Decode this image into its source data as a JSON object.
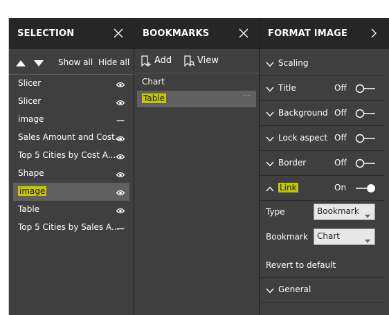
{
  "selection": {
    "title": "SELECTION",
    "show_all": "Show all",
    "hide_all": "Hide all",
    "items": [
      {
        "label": "Slicer",
        "visibility": "eye-icon"
      },
      {
        "label": "Slicer",
        "visibility": "eye-icon"
      },
      {
        "label": "image",
        "visibility": "hidden-dash-icon"
      },
      {
        "label": "Sales Amount and Cost...",
        "visibility": "eye-icon"
      },
      {
        "label": "Top 5 Cities by Cost A...",
        "visibility": "eye-icon"
      },
      {
        "label": "Shape",
        "visibility": "eye-icon"
      },
      {
        "label": "image",
        "visibility": "eye-icon"
      },
      {
        "label": "Table",
        "visibility": "eye-icon"
      },
      {
        "label": "Top 5 Cities by Sales A...",
        "visibility": "hidden-dash-icon"
      }
    ]
  },
  "bookmarks": {
    "title": "BOOKMARKS",
    "add_label": "Add",
    "view_label": "View",
    "items": [
      {
        "label": "Chart"
      },
      {
        "label": "Table",
        "more": "···"
      }
    ]
  },
  "format": {
    "title": "FORMAT IMAGE",
    "sections": {
      "scaling": {
        "name": "Scaling"
      },
      "title": {
        "name": "Title",
        "state": "Off"
      },
      "background": {
        "name": "Background",
        "state": "Off"
      },
      "lock_aspect": {
        "name": "Lock aspect",
        "state": "Off"
      },
      "border": {
        "name": "Border",
        "state": "Off"
      },
      "link": {
        "name": "Link",
        "state": "On"
      },
      "general": {
        "name": "General"
      }
    },
    "type": {
      "label": "Type",
      "value": "Bookmark"
    },
    "bookmark": {
      "label": "Bookmark",
      "value": "Chart"
    },
    "revert": "Revert to default"
  },
  "colors": {
    "pane_bg": "#3f3f3f",
    "header_bg": "#262626",
    "selected_row": "#606060",
    "highlight": "#c8c800"
  }
}
